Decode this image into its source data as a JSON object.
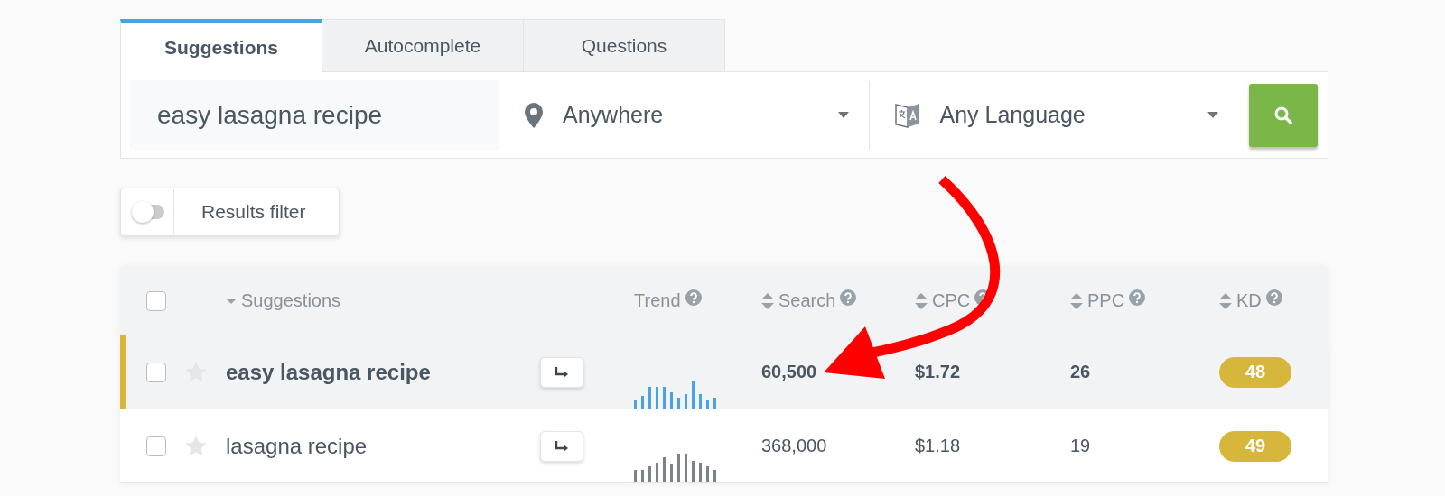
{
  "tabs": [
    {
      "label": "Suggestions",
      "selected": true
    },
    {
      "label": "Autocomplete",
      "selected": false
    },
    {
      "label": "Questions",
      "selected": false
    }
  ],
  "search": {
    "value": "easy lasagna recipe",
    "location": "Anywhere",
    "language": "Any Language"
  },
  "results_filter": {
    "label": "Results filter",
    "on": false
  },
  "table": {
    "select_all": {
      "checked": false
    },
    "columns": [
      {
        "label": "Suggestions",
        "kind": "sorted",
        "help": false
      },
      {
        "label": "Trend",
        "kind": "plain",
        "help": true
      },
      {
        "label": "Search",
        "kind": "sortable",
        "help": true
      },
      {
        "label": "CPC",
        "kind": "sortable",
        "help": true
      },
      {
        "label": "PPC",
        "kind": "sortable",
        "help": true
      },
      {
        "label": "KD",
        "kind": "sortable",
        "help": true
      }
    ],
    "rows": [
      {
        "selected": true,
        "checked": false,
        "starred": false,
        "keyword": "easy lasagna recipe",
        "search": "60,500",
        "cpc": "$1.72",
        "ppc": "26",
        "kd": {
          "value": "48",
          "color": "#d6b73c"
        }
      },
      {
        "selected": false,
        "checked": false,
        "starred": false,
        "keyword": "lasagna recipe",
        "search": "368,000",
        "cpc": "$1.18",
        "ppc": "19",
        "kd": {
          "value": "49",
          "color": "#d6b73c"
        }
      }
    ]
  }
}
